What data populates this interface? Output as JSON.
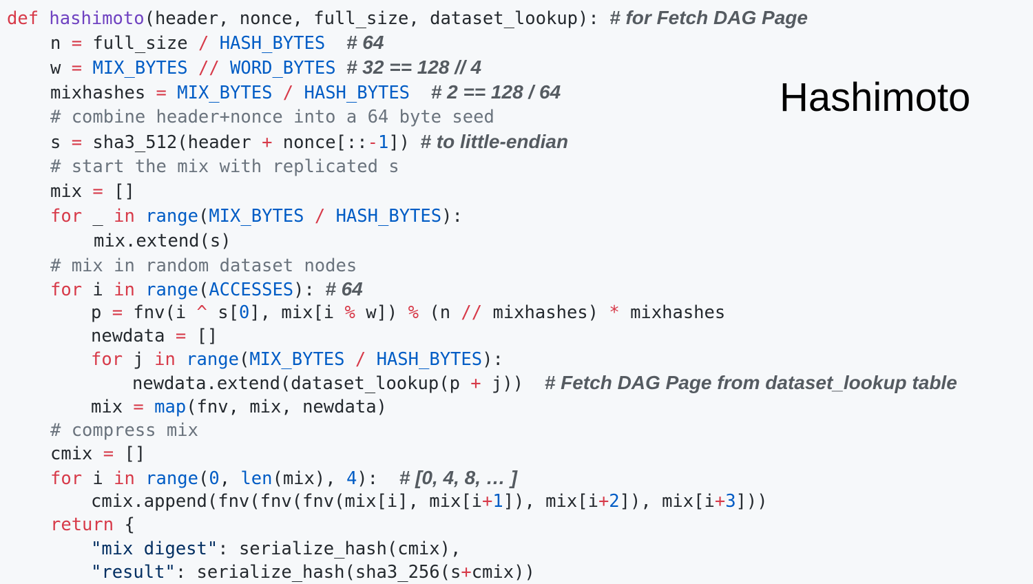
{
  "slide": {
    "title": "Hashimoto"
  },
  "colors": {
    "background": "#f6f8fa",
    "keyword": "#d73a49",
    "function_name": "#6f42c1",
    "constant": "#005cc5",
    "string": "#032f62",
    "comment": "#6a737d",
    "annotation": "#555b61",
    "text": "#24292e"
  },
  "code": {
    "lines": [
      [
        [
          "kw",
          "def "
        ],
        [
          "fn",
          "hashimoto"
        ],
        [
          "tx",
          "(header, nonce, full_size, dataset_lookup): "
        ],
        [
          "note",
          "# for Fetch DAG Page"
        ]
      ],
      [
        [
          "tx",
          "n "
        ],
        [
          "op",
          "="
        ],
        [
          "tx",
          " full_size "
        ],
        [
          "op",
          "/"
        ],
        [
          "tx",
          " "
        ],
        [
          "cn",
          "HASH_BYTES"
        ],
        [
          "tx",
          "  "
        ],
        [
          "note",
          "# 64"
        ]
      ],
      [
        [
          "tx",
          "w "
        ],
        [
          "op",
          "="
        ],
        [
          "tx",
          " "
        ],
        [
          "cn",
          "MIX_BYTES"
        ],
        [
          "tx",
          " "
        ],
        [
          "op",
          "//"
        ],
        [
          "tx",
          " "
        ],
        [
          "cn",
          "WORD_BYTES"
        ],
        [
          "tx",
          " "
        ],
        [
          "note",
          "# 32 == 128 // 4"
        ]
      ],
      [
        [
          "tx",
          "mixhashes "
        ],
        [
          "op",
          "="
        ],
        [
          "tx",
          " "
        ],
        [
          "cn",
          "MIX_BYTES"
        ],
        [
          "tx",
          " "
        ],
        [
          "op",
          "/"
        ],
        [
          "tx",
          " "
        ],
        [
          "cn",
          "HASH_BYTES"
        ],
        [
          "tx",
          "  "
        ],
        [
          "note",
          "# 2 == 128 / 64"
        ]
      ],
      [
        [
          "cmt",
          "# combine header+nonce into a 64 byte seed"
        ]
      ],
      [
        [
          "tx",
          "s "
        ],
        [
          "op",
          "="
        ],
        [
          "tx",
          " sha3_512(header "
        ],
        [
          "op",
          "+"
        ],
        [
          "tx",
          " nonce[::"
        ],
        [
          "op",
          "-"
        ],
        [
          "cn",
          "1"
        ],
        [
          "tx",
          "]) "
        ],
        [
          "note",
          "# to little-endian"
        ]
      ],
      [
        [
          "cmt",
          "# start the mix with replicated s"
        ]
      ],
      [
        [
          "tx",
          "mix "
        ],
        [
          "op",
          "="
        ],
        [
          "tx",
          " []"
        ]
      ],
      [
        [
          "kw",
          "for"
        ],
        [
          "tx",
          " _ "
        ],
        [
          "kw",
          "in"
        ],
        [
          "tx",
          " "
        ],
        [
          "cn",
          "range"
        ],
        [
          "tx",
          "("
        ],
        [
          "cn",
          "MIX_BYTES"
        ],
        [
          "tx",
          " "
        ],
        [
          "op",
          "/"
        ],
        [
          "tx",
          " "
        ],
        [
          "cn",
          "HASH_BYTES"
        ],
        [
          "tx",
          "):"
        ]
      ],
      [
        [
          "tx",
          "mix.extend(s)"
        ]
      ],
      [
        [
          "cmt",
          "# mix in random dataset nodes"
        ]
      ],
      [
        [
          "kw",
          "for"
        ],
        [
          "tx",
          " i "
        ],
        [
          "kw",
          "in"
        ],
        [
          "tx",
          " "
        ],
        [
          "cn",
          "range"
        ],
        [
          "tx",
          "("
        ],
        [
          "cn",
          "ACCESSES"
        ],
        [
          "tx",
          "): "
        ],
        [
          "note",
          "# 64"
        ]
      ],
      [
        [
          "tx",
          "p "
        ],
        [
          "op",
          "="
        ],
        [
          "tx",
          " fnv(i "
        ],
        [
          "op",
          "^"
        ],
        [
          "tx",
          " s["
        ],
        [
          "cn",
          "0"
        ],
        [
          "tx",
          "], mix[i "
        ],
        [
          "op",
          "%"
        ],
        [
          "tx",
          " w]) "
        ],
        [
          "op",
          "%"
        ],
        [
          "tx",
          " (n "
        ],
        [
          "op",
          "//"
        ],
        [
          "tx",
          " mixhashes) "
        ],
        [
          "op",
          "*"
        ],
        [
          "tx",
          " mixhashes"
        ]
      ],
      [
        [
          "tx",
          "newdata "
        ],
        [
          "op",
          "="
        ],
        [
          "tx",
          " []"
        ]
      ],
      [
        [
          "kw",
          "for"
        ],
        [
          "tx",
          " j "
        ],
        [
          "kw",
          "in"
        ],
        [
          "tx",
          " "
        ],
        [
          "cn",
          "range"
        ],
        [
          "tx",
          "("
        ],
        [
          "cn",
          "MIX_BYTES"
        ],
        [
          "tx",
          " "
        ],
        [
          "op",
          "/"
        ],
        [
          "tx",
          " "
        ],
        [
          "cn",
          "HASH_BYTES"
        ],
        [
          "tx",
          "):"
        ]
      ],
      [
        [
          "tx",
          "newdata.extend(dataset_lookup(p "
        ],
        [
          "op",
          "+"
        ],
        [
          "tx",
          " j))  "
        ],
        [
          "note",
          "# Fetch DAG Page from dataset_lookup table"
        ]
      ],
      [
        [
          "tx",
          "mix "
        ],
        [
          "op",
          "="
        ],
        [
          "tx",
          " "
        ],
        [
          "cn",
          "map"
        ],
        [
          "tx",
          "(fnv, mix, newdata)"
        ]
      ],
      [
        [
          "cmt",
          "# compress mix"
        ]
      ],
      [
        [
          "tx",
          "cmix "
        ],
        [
          "op",
          "="
        ],
        [
          "tx",
          " []"
        ]
      ],
      [
        [
          "kw",
          "for"
        ],
        [
          "tx",
          " i "
        ],
        [
          "kw",
          "in"
        ],
        [
          "tx",
          " "
        ],
        [
          "cn",
          "range"
        ],
        [
          "tx",
          "("
        ],
        [
          "cn",
          "0"
        ],
        [
          "tx",
          ", "
        ],
        [
          "cn",
          "len"
        ],
        [
          "tx",
          "(mix), "
        ],
        [
          "cn",
          "4"
        ],
        [
          "tx",
          "):  "
        ],
        [
          "note",
          "# [0, 4, 8, … ]"
        ]
      ],
      [
        [
          "tx",
          "cmix.append(fnv(fnv(fnv(mix[i], mix[i"
        ],
        [
          "op",
          "+"
        ],
        [
          "cn",
          "1"
        ],
        [
          "tx",
          "]), mix[i"
        ],
        [
          "op",
          "+"
        ],
        [
          "cn",
          "2"
        ],
        [
          "tx",
          "]), mix[i"
        ],
        [
          "op",
          "+"
        ],
        [
          "cn",
          "3"
        ],
        [
          "tx",
          "]))"
        ]
      ],
      [
        [
          "kw",
          "return"
        ],
        [
          "tx",
          " {"
        ]
      ],
      [
        [
          "str",
          "\"mix digest\""
        ],
        [
          "tx",
          ": serialize_hash(cmix),"
        ]
      ],
      [
        [
          "str",
          "\"result\""
        ],
        [
          "tx",
          ": serialize_hash(sha3_256(s"
        ],
        [
          "op",
          "+"
        ],
        [
          "tx",
          "cmix))"
        ]
      ]
    ]
  }
}
